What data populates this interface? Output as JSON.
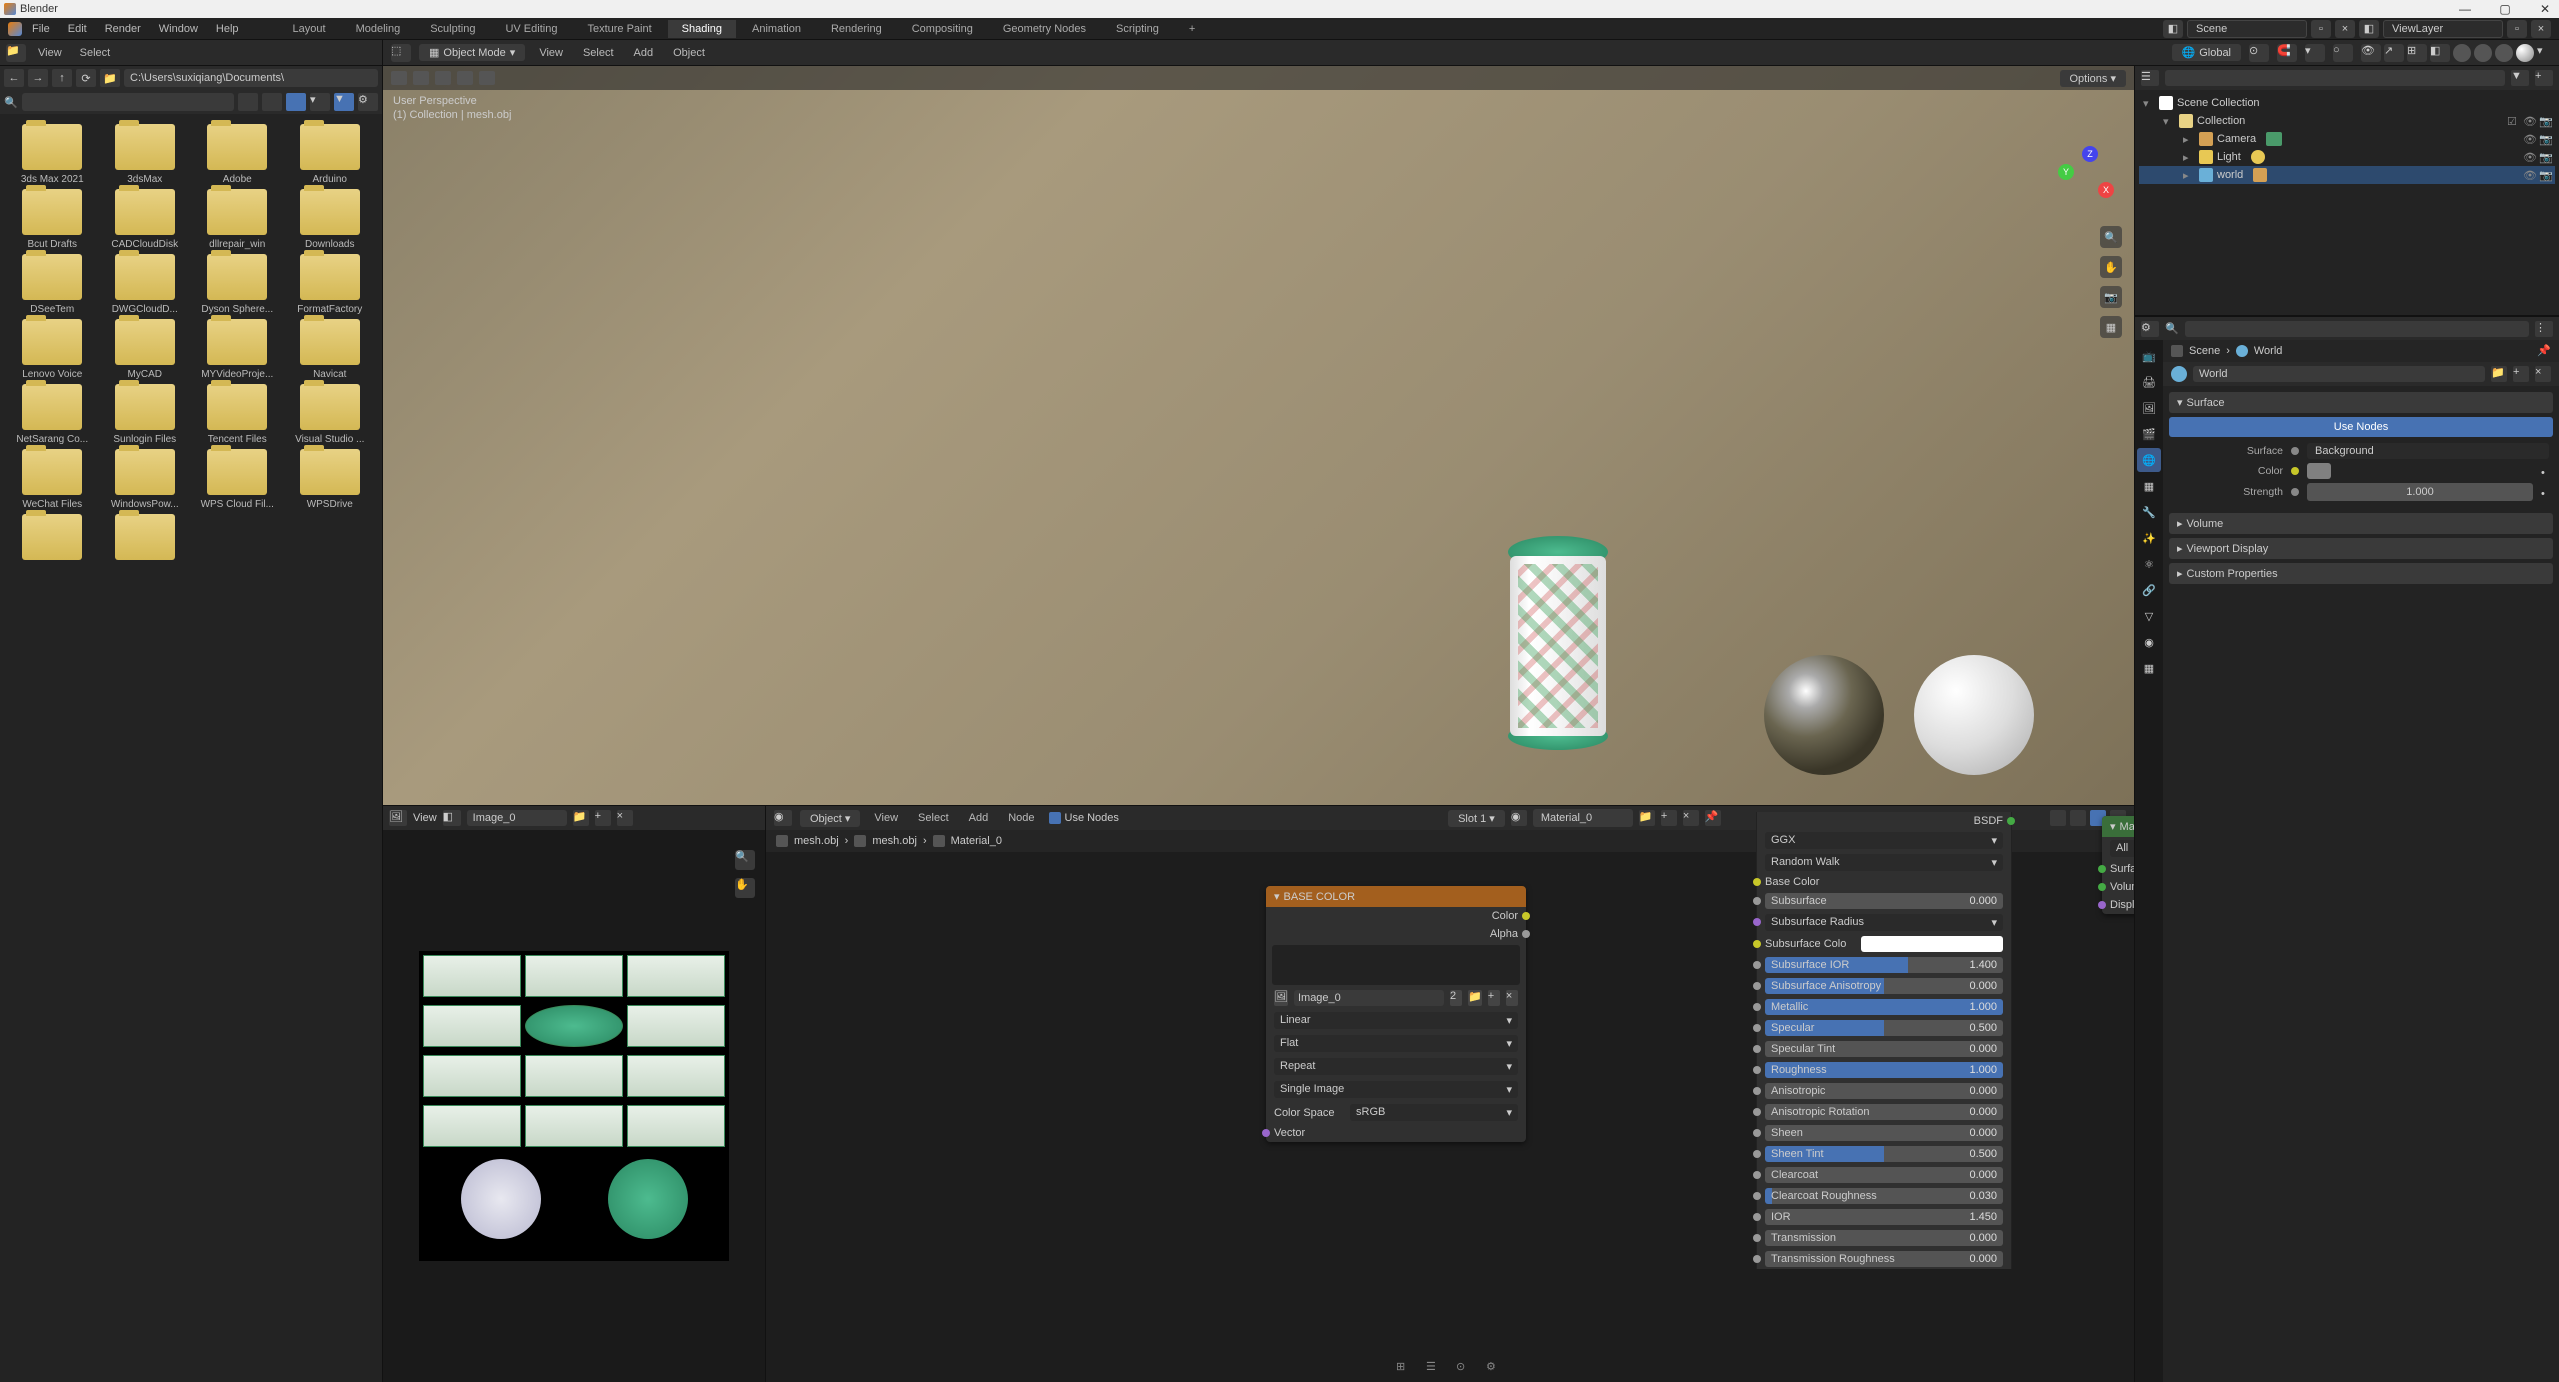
{
  "app": {
    "title": "Blender"
  },
  "window_controls": {
    "min": "—",
    "max": "▢",
    "close": "✕"
  },
  "menu": {
    "file": "File",
    "edit": "Edit",
    "render": "Render",
    "window": "Window",
    "help": "Help"
  },
  "workspaces": {
    "layout": "Layout",
    "modeling": "Modeling",
    "sculpting": "Sculpting",
    "uv": "UV Editing",
    "texpaint": "Texture Paint",
    "shading": "Shading",
    "animation": "Animation",
    "rendering": "Rendering",
    "compositing": "Compositing",
    "geonodes": "Geometry Nodes",
    "scripting": "Scripting",
    "add": "+"
  },
  "scene": {
    "label": "Scene",
    "layer": "ViewLayer"
  },
  "toolbar": {
    "view": "View",
    "select": "Select",
    "mode": "Object Mode",
    "vp_view": "View",
    "vp_select": "Select",
    "vp_add": "Add",
    "vp_object": "Object",
    "orientation": "Global",
    "options": "Options"
  },
  "viewport": {
    "info_line1": "User Perspective",
    "info_line2": "(1) Collection | mesh.obj"
  },
  "filebrowser": {
    "path": "C:\\Users\\suxiqiang\\Documents\\",
    "search_placeholder": "",
    "items": [
      "3ds Max 2021",
      "3dsMax",
      "Adobe",
      "Arduino",
      "Bcut Drafts",
      "CADCloudDisk",
      "dllrepair_win",
      "Downloads",
      "DSeeTem",
      "DWGCloudD...",
      "Dyson Sphere...",
      "FormatFactory",
      "Lenovo Voice",
      "MyCAD",
      "MYVideoProje...",
      "Navicat",
      "NetSarang Co...",
      "Sunlogin Files",
      "Tencent Files",
      "Visual Studio ...",
      "WeChat Files",
      "WindowsPow...",
      "WPS Cloud Fil...",
      "WPSDrive",
      "",
      ""
    ]
  },
  "image_editor": {
    "view": "View",
    "image_name": "Image_0"
  },
  "node_editor": {
    "object": "Object",
    "view": "View",
    "select": "Select",
    "add": "Add",
    "node": "Node",
    "use_nodes": "Use Nodes",
    "slot": "Slot 1",
    "material": "Material_0",
    "breadcrumb": {
      "mesh1": "mesh.obj",
      "mesh2": "mesh.obj",
      "mat": "Material_0"
    }
  },
  "node_image": {
    "title": "BASE COLOR",
    "color": "Color",
    "alpha": "Alpha",
    "image": "Image_0",
    "interp": "Linear",
    "projection": "Flat",
    "extension": "Repeat",
    "source": "Single Image",
    "colorspace_label": "Color Space",
    "colorspace": "sRGB",
    "vector": "Vector"
  },
  "node_bsdf": {
    "bsdf": "BSDF",
    "distribution": "GGX",
    "subsurface_method": "Random Walk",
    "base_color": "Base Color",
    "subsurface": {
      "label": "Subsurface",
      "value": "0.000"
    },
    "ss_radius": "Subsurface Radius",
    "ss_color": "Subsurface Colo",
    "ss_ior": {
      "label": "Subsurface IOR",
      "value": "1.400"
    },
    "ss_aniso": {
      "label": "Subsurface Anisotropy",
      "value": "0.000"
    },
    "metallic": {
      "label": "Metallic",
      "value": "1.000"
    },
    "specular": {
      "label": "Specular",
      "value": "0.500"
    },
    "spec_tint": {
      "label": "Specular Tint",
      "value": "0.000"
    },
    "roughness": {
      "label": "Roughness",
      "value": "1.000"
    },
    "anisotropic": {
      "label": "Anisotropic",
      "value": "0.000"
    },
    "aniso_rot": {
      "label": "Anisotropic Rotation",
      "value": "0.000"
    },
    "sheen": {
      "label": "Sheen",
      "value": "0.000"
    },
    "sheen_tint": {
      "label": "Sheen Tint",
      "value": "0.500"
    },
    "clearcoat": {
      "label": "Clearcoat",
      "value": "0.000"
    },
    "cc_rough": {
      "label": "Clearcoat Roughness",
      "value": "0.030"
    },
    "ior": {
      "label": "IOR",
      "value": "1.450"
    },
    "transmission": {
      "label": "Transmission",
      "value": "0.000"
    },
    "trans_rough": {
      "label": "Transmission Roughness",
      "value": "0.000"
    }
  },
  "node_output": {
    "title": "Material Output",
    "target": "All",
    "surface": "Surface",
    "volume": "Volume",
    "displacement": "Displacement"
  },
  "outliner": {
    "search_placeholder": "",
    "scene_collection": "Scene Collection",
    "collection": "Collection",
    "camera": "Camera",
    "light": "Light",
    "world": "world"
  },
  "properties": {
    "breadcrumb": {
      "scene": "Scene",
      "world": "World"
    },
    "world_name": "World",
    "surface_panel": "Surface",
    "use_nodes": "Use Nodes",
    "surface_label": "Surface",
    "surface_value": "Background",
    "color_label": "Color",
    "strength_label": "Strength",
    "strength_value": "1.000",
    "volume_panel": "Volume",
    "viewport_panel": "Viewport Display",
    "custom_panel": "Custom Properties"
  }
}
